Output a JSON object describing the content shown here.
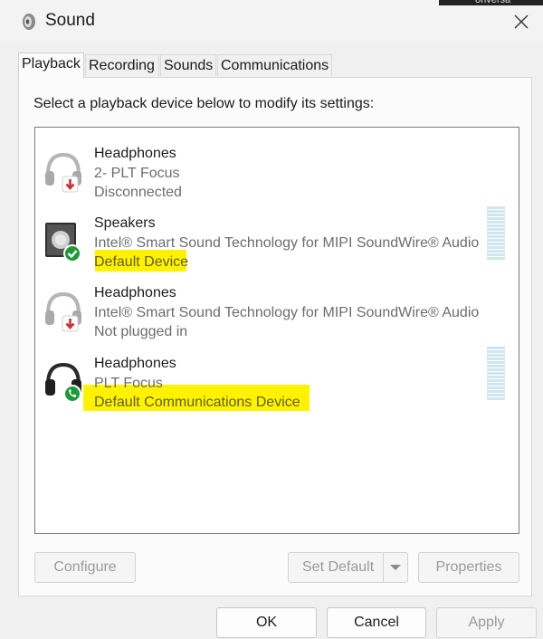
{
  "window": {
    "title": "Sound"
  },
  "background_app": {
    "text": "onversa"
  },
  "tabs": [
    {
      "label": "Playback",
      "active": true
    },
    {
      "label": "Recording",
      "active": false
    },
    {
      "label": "Sounds",
      "active": false
    },
    {
      "label": "Communications",
      "active": false
    }
  ],
  "instruction": "Select a playback device below to modify its settings:",
  "devices": [
    {
      "name": "Headphones",
      "detail": "2- PLT Focus",
      "status": "Disconnected",
      "icon": "headphones-disconnected-icon",
      "highlighted": false
    },
    {
      "name": "Speakers",
      "detail": "Intel® Smart Sound Technology for MIPI SoundWire® Audio",
      "status": "Default Device",
      "icon": "speakers-default-icon",
      "highlighted": true
    },
    {
      "name": "Headphones",
      "detail": "Intel® Smart Sound Technology for MIPI SoundWire® Audio",
      "status": "Not plugged in",
      "icon": "headphones-unplugged-icon",
      "highlighted": false
    },
    {
      "name": "Headphones",
      "detail": "PLT Focus",
      "status": "Default Communications Device",
      "icon": "headphones-communications-icon",
      "highlighted": true
    }
  ],
  "buttons": {
    "configure": "Configure",
    "set_default": "Set Default",
    "properties": "Properties",
    "ok": "OK",
    "cancel": "Cancel",
    "apply": "Apply"
  },
  "colors": {
    "highlight": "#fff200",
    "default_check": "#1c9a3b",
    "disconnected_arrow": "#d32f2f"
  }
}
